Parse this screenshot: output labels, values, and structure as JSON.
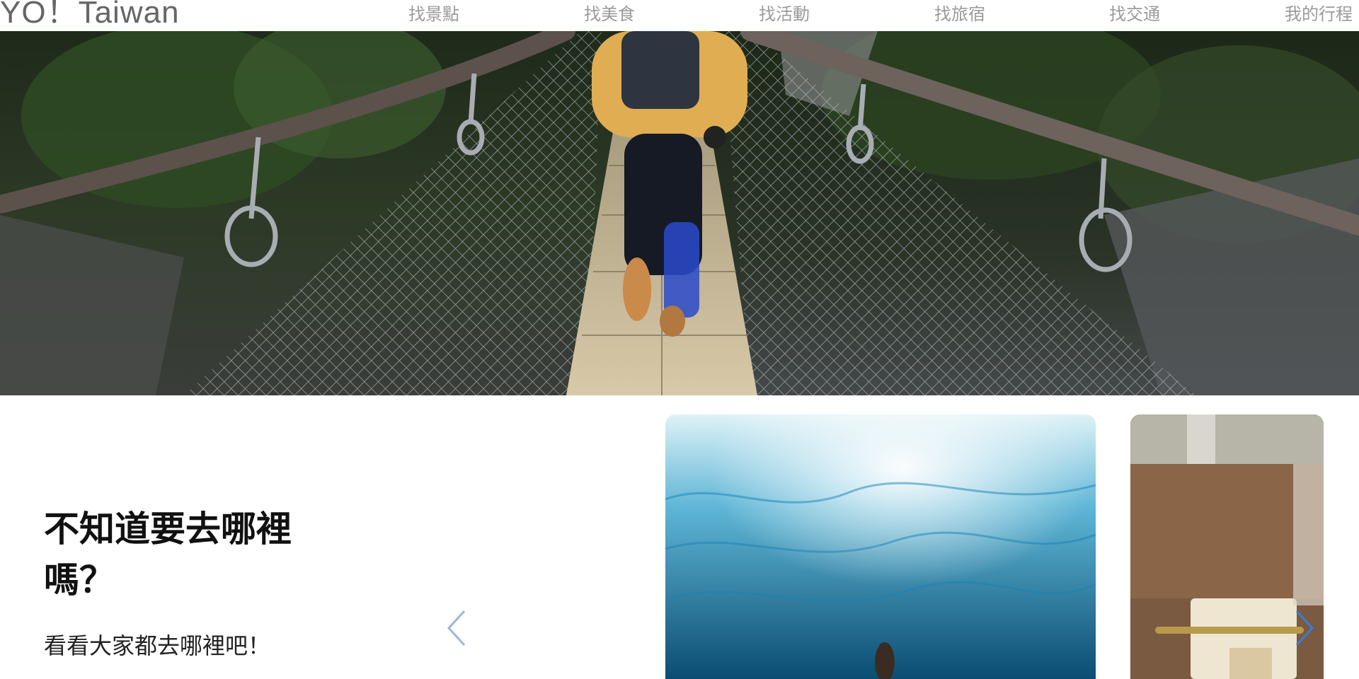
{
  "brand": {
    "logo_text": "YO！Taiwan"
  },
  "nav": {
    "items": [
      {
        "label": "找景點"
      },
      {
        "label": "找美食"
      },
      {
        "label": "找活動"
      },
      {
        "label": "找旅宿"
      },
      {
        "label": "找交通"
      },
      {
        "label": "我的行程"
      }
    ]
  },
  "hero": {
    "image_subject": "person running on a suspension bridge",
    "active_slide": 1
  },
  "promo": {
    "heading": "不知道要去哪裡嗎？",
    "subheading": "看看大家都去哪裡吧！"
  },
  "carousel": {
    "prev_icon": "chevron-left-icon",
    "next_icon": "chevron-right-icon",
    "cards": [
      {
        "image_subject": "underwater ocean view"
      },
      {
        "image_subject": "cafe interior with dessert"
      }
    ]
  },
  "colors": {
    "nav_text": "#9a9a9a",
    "logo_text": "#666666",
    "arrow": "#9bb7d9",
    "accent": "#3a7bd5"
  }
}
